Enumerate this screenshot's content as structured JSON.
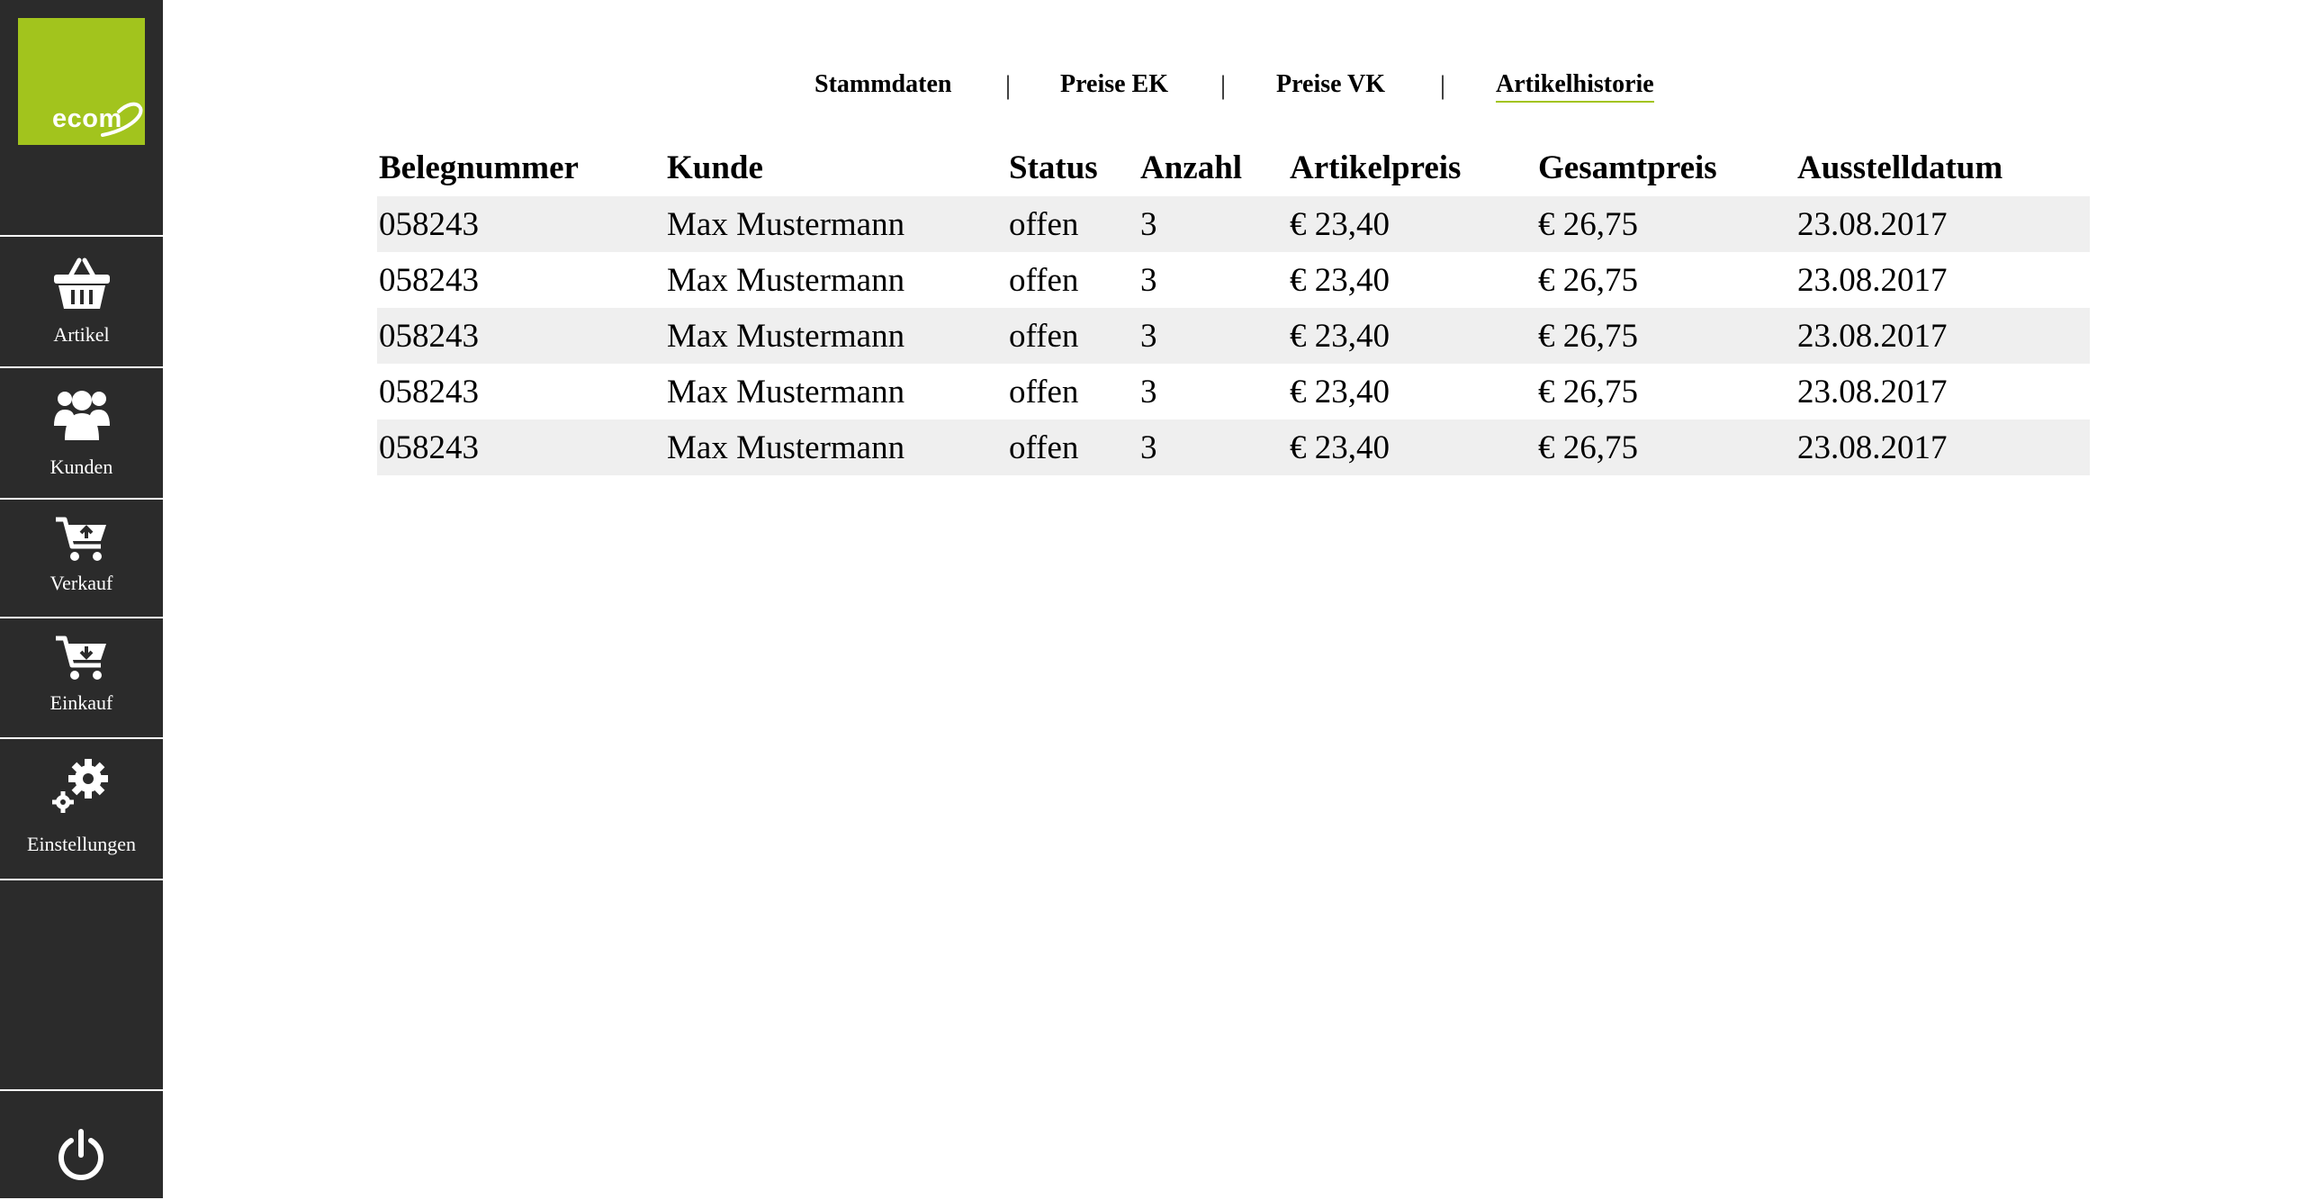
{
  "logo": {
    "text": "ecom"
  },
  "brand_color": "#a2c41d",
  "sidebar": {
    "items": [
      {
        "label": "Artikel",
        "icon": "basket-icon"
      },
      {
        "label": "Kunden",
        "icon": "users-icon"
      },
      {
        "label": "Verkauf",
        "icon": "cart-upload-icon"
      },
      {
        "label": "Einkauf",
        "icon": "cart-download-icon"
      },
      {
        "label": "Einstellungen",
        "icon": "gears-icon"
      }
    ],
    "power_icon": "power-icon"
  },
  "tabs": [
    {
      "label": "Stammdaten"
    },
    {
      "label": "Preise EK"
    },
    {
      "label": "Preise VK"
    },
    {
      "label": "Artikelhistorie",
      "active": true
    }
  ],
  "tab_separator": "|",
  "table": {
    "headers": [
      "Belegnummer",
      "Kunde",
      "Status",
      "Anzahl",
      "Artikelpreis",
      "Gesamtpreis",
      "Ausstelldatum"
    ],
    "rows": [
      [
        "058243",
        "Max Mustermann",
        "offen",
        "3",
        "€ 23,40",
        "€ 26,75",
        "23.08.2017"
      ],
      [
        "058243",
        "Max Mustermann",
        "offen",
        "3",
        "€ 23,40",
        "€ 26,75",
        "23.08.2017"
      ],
      [
        "058243",
        "Max Mustermann",
        "offen",
        "3",
        "€ 23,40",
        "€ 26,75",
        "23.08.2017"
      ],
      [
        "058243",
        "Max Mustermann",
        "offen",
        "3",
        "€ 23,40",
        "€ 26,75",
        "23.08.2017"
      ],
      [
        "058243",
        "Max Mustermann",
        "offen",
        "3",
        "€ 23,40",
        "€ 26,75",
        "23.08.2017"
      ]
    ]
  }
}
